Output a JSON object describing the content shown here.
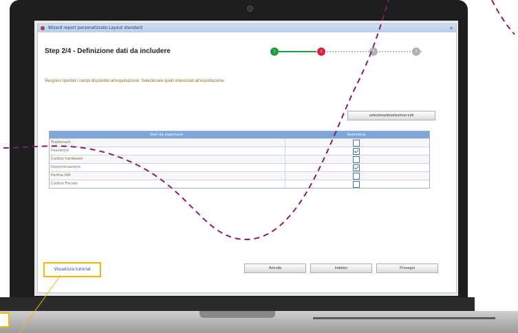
{
  "window": {
    "title": "Wizard report personalizzato Layout standard",
    "close_symbol": "×"
  },
  "step": {
    "title": "Step 2/4 - Definizione dati da includere",
    "numbers": [
      "1",
      "2",
      "3",
      "4"
    ],
    "current": 2,
    "colors": {
      "done": "#1a9c3e",
      "current": "#d9233a",
      "pending": "#b0b0b0"
    }
  },
  "intro_text": "Vengono riportati i campi disponibili all'esportazione. Selezionare quelli interessati all'esportazione.",
  "select_all_label": "seleziona/deseleziona tutti",
  "table": {
    "headers": [
      "Dati da esportare",
      "Seleziona"
    ],
    "rows": [
      {
        "field": "Trademark",
        "selected": false
      },
      {
        "field": "Password",
        "selected": true
      },
      {
        "field": "Codice hardware",
        "selected": false
      },
      {
        "field": "Denominazione",
        "selected": true
      },
      {
        "field": "Partita IVA",
        "selected": false
      },
      {
        "field": "Codice Fiscale",
        "selected": false
      }
    ]
  },
  "tutorial_label": "Visualizza tutorial",
  "buttons": {
    "cancel": "Annulla",
    "back": "Indietro",
    "next": "Prosegui"
  },
  "colors": {
    "highlight": "#f5b700",
    "dashed_path": "#8a1a6e"
  }
}
